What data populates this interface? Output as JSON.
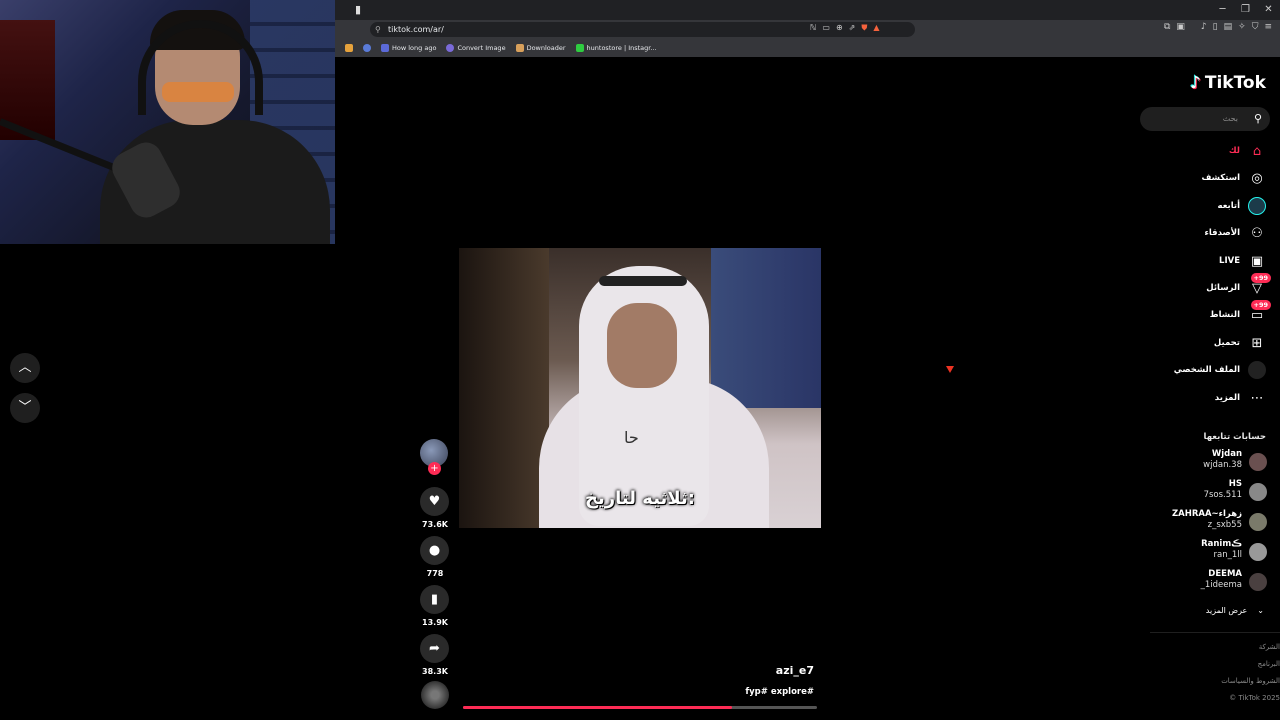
{
  "browser": {
    "url": "tiktok.com/ar/",
    "bookmarks": [
      {
        "label": "How long ago",
        "color": "#5b6ad8"
      },
      {
        "label": "Convert Image",
        "color": "#7a6ad8"
      },
      {
        "label": "Downloader",
        "color": "#d8a05b"
      },
      {
        "label": "huntostore | Instagr...",
        "color": "#2ecc40"
      }
    ]
  },
  "sidebar": {
    "logo": "TikTok",
    "search_placeholder": "بحث",
    "menu": [
      {
        "label": "لك",
        "icon": "home-icon",
        "glyph": "⌂"
      },
      {
        "label": "استكشف",
        "icon": "compass-icon",
        "glyph": "◎"
      },
      {
        "label": "أتابعه",
        "icon": "following-avatar",
        "glyph": ""
      },
      {
        "label": "الأصدقاء",
        "icon": "friends-icon",
        "glyph": "👥"
      },
      {
        "label": "LIVE",
        "icon": "live-icon",
        "glyph": "▣"
      },
      {
        "label": "الرسائل",
        "icon": "messages-icon",
        "glyph": "▽",
        "badge": "+99"
      },
      {
        "label": "النشاط",
        "icon": "activity-icon",
        "glyph": "▭",
        "badge": "+99"
      },
      {
        "label": "تحميل",
        "icon": "upload-icon",
        "glyph": "⊞"
      },
      {
        "label": "الملف الشخصي",
        "icon": "profile-avatar",
        "glyph": ""
      },
      {
        "label": "المزيد",
        "icon": "more-icon",
        "glyph": "⋯"
      }
    ],
    "following_title": "حسابات تتابعها",
    "accounts": [
      {
        "name": "Wjdan",
        "handle": "wjdan.38"
      },
      {
        "name": "HS",
        "handle": "7sos.511"
      },
      {
        "name": "ZAHRAA~زهراء",
        "handle": "z_sxb55"
      },
      {
        "name": "Ranimڪ",
        "handle": "ran_1ll"
      },
      {
        "name": "DEEMA",
        "handle": "_1ideema"
      }
    ],
    "see_more": "عرض المزيد",
    "footer": [
      "الشركة",
      "البرنامج",
      "الشروط والسياسات",
      "© TikTok 2025"
    ]
  },
  "video": {
    "caption": "ثلاثيه لتاريخ:",
    "hand_note": "حا",
    "username": "azi_e7",
    "hashtags": "fyp# explore#",
    "progress": 0.76
  },
  "actions": {
    "likes": "73.6K",
    "comments": "778",
    "saves": "13.9K",
    "shares": "38.3K"
  }
}
